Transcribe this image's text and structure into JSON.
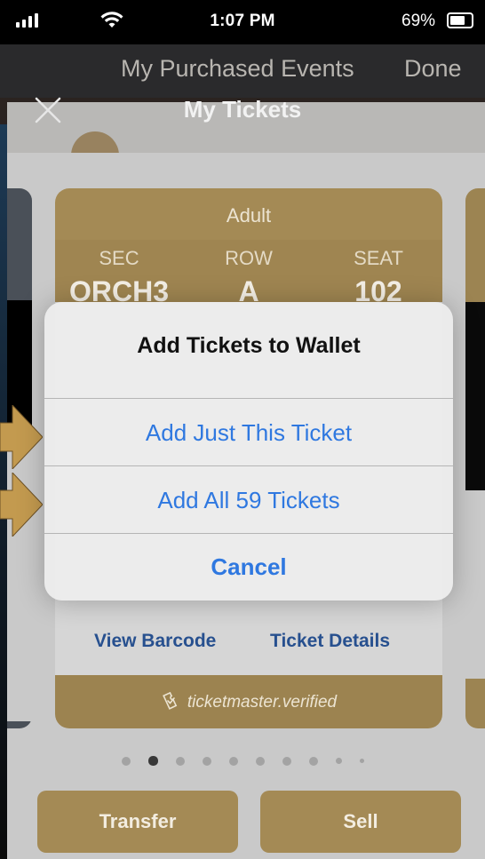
{
  "status_bar": {
    "time": "1:07 PM",
    "battery": "69%"
  },
  "nav": {
    "back_title": "My Purchased Events",
    "done": "Done"
  },
  "sheet": {
    "title": "My Tickets"
  },
  "ticket": {
    "type": "Adult",
    "columns": [
      {
        "label": "SEC",
        "value": "ORCH3"
      },
      {
        "label": "ROW",
        "value": "A"
      },
      {
        "label": "SEAT",
        "value": "102"
      }
    ],
    "view_barcode": "View Barcode",
    "ticket_details": "Ticket Details",
    "verified_brand": "ticketmaster",
    "verified_suffix": ".verified"
  },
  "pager": {
    "current_page": 2,
    "dot_count": 10
  },
  "actions": {
    "transfer": "Transfer",
    "sell": "Sell"
  },
  "alert": {
    "title": "Add Tickets to Wallet",
    "add_one": "Add Just This Ticket",
    "add_all": "Add All 59 Tickets",
    "cancel": "Cancel"
  },
  "colors": {
    "accent_gold": "#a48a55",
    "alert_button_blue": "#2f78e0",
    "link_blue": "#27508f",
    "annotation_arrow": "#c39a4f"
  },
  "icons": [
    "signal-icon",
    "wifi-icon",
    "battery-icon",
    "close-icon",
    "ticketmaster-verified-icon",
    "arrow-pointer-icon"
  ]
}
